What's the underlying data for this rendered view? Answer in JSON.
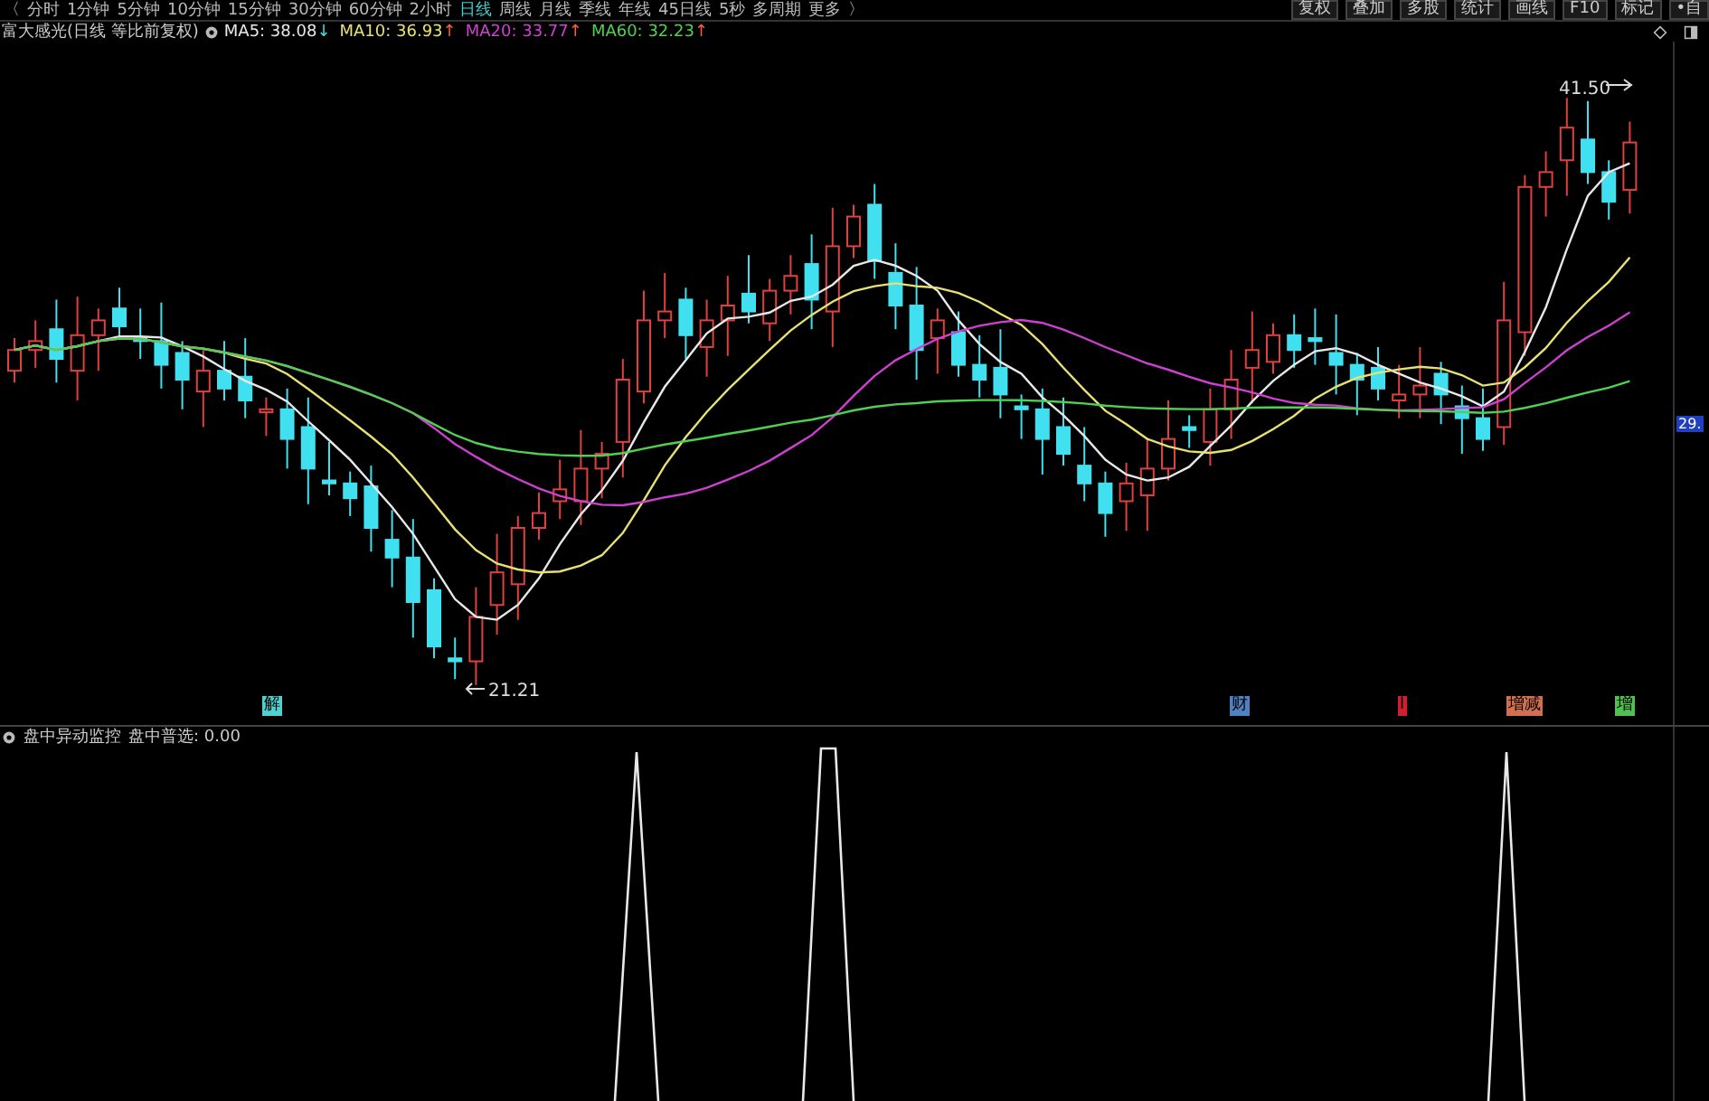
{
  "toolbar": {
    "back": "〈",
    "periods": [
      {
        "label": "分时",
        "selected": false
      },
      {
        "label": "1分钟",
        "selected": false
      },
      {
        "label": "5分钟",
        "selected": false
      },
      {
        "label": "10分钟",
        "selected": false
      },
      {
        "label": "15分钟",
        "selected": false
      },
      {
        "label": "30分钟",
        "selected": false
      },
      {
        "label": "60分钟",
        "selected": false
      },
      {
        "label": "2小时",
        "selected": false
      },
      {
        "label": "日线",
        "selected": true
      },
      {
        "label": "周线",
        "selected": false
      },
      {
        "label": "月线",
        "selected": false
      },
      {
        "label": "季线",
        "selected": false
      },
      {
        "label": "年线",
        "selected": false
      },
      {
        "label": "45日线",
        "selected": false
      },
      {
        "label": "5秒",
        "selected": false
      },
      {
        "label": "多周期",
        "selected": false
      },
      {
        "label": "更多",
        "selected": false
      }
    ],
    "forward": "〉",
    "actions": [
      "复权",
      "叠加",
      "多股",
      "统计",
      "画线",
      "F10",
      "标记",
      "•自"
    ]
  },
  "legend": {
    "title": "富大感光(日线 等比前复权)",
    "ma": [
      {
        "label": "MA5: 38.08",
        "color": "#e8e8e8",
        "trend": {
          "text": "↓",
          "color": "#40e0e0"
        }
      },
      {
        "label": "MA10: 36.93",
        "color": "#e8e070",
        "trend": {
          "text": "↑",
          "color": "#ff6030"
        }
      },
      {
        "label": "MA20: 33.77",
        "color": "#d040d0",
        "trend": {
          "text": "↑",
          "color": "#ff6030"
        }
      },
      {
        "label": "MA60: 32.23",
        "color": "#50d050",
        "trend": {
          "text": "↑",
          "color": "#ff6030"
        }
      }
    ]
  },
  "main_chart": {
    "high_label": "41.50",
    "low_label": "21.21",
    "price_tag": "29.",
    "markers": [
      {
        "text": "解",
        "color": "#50d0d0"
      },
      {
        "text": "财",
        "color": "#5080c0"
      },
      {
        "text": "l",
        "color": "#d02030"
      },
      {
        "text": "增减",
        "color": "#d07050"
      },
      {
        "text": "增",
        "color": "#50c050"
      }
    ]
  },
  "indicator": {
    "name": "盘中异动监控",
    "value_label": "盘中普选: 0.00"
  }
}
